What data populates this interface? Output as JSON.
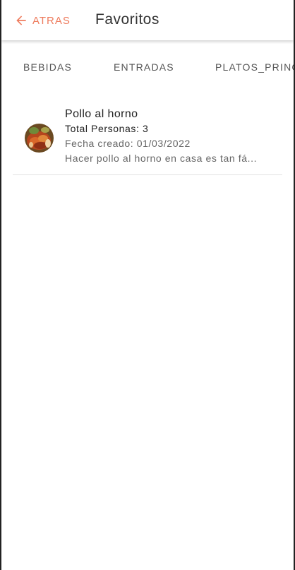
{
  "header": {
    "back_label": "ATRAS",
    "title": "Favoritos",
    "back_icon": "arrow-left-icon",
    "accent_color": "#ee7c5e"
  },
  "tabs": [
    {
      "label": "BEBIDAS"
    },
    {
      "label": "ENTRADAS"
    },
    {
      "label": "PLATOS_PRINC"
    }
  ],
  "favorites": [
    {
      "title": "Pollo al horno",
      "persons": "Total Personas: 3",
      "date": "Fecha creado: 01/03/2022",
      "description": "Hacer pollo al horno en casa es tan fá..."
    }
  ]
}
